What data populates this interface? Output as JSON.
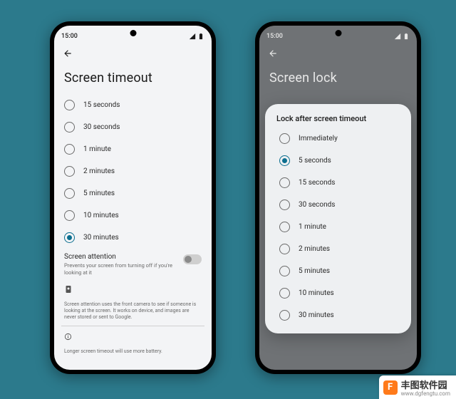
{
  "status_time": "15:00",
  "phone_left": {
    "title": "Screen timeout",
    "options": [
      {
        "label": "15 seconds",
        "selected": false
      },
      {
        "label": "30 seconds",
        "selected": false
      },
      {
        "label": "1 minute",
        "selected": false
      },
      {
        "label": "2 minutes",
        "selected": false
      },
      {
        "label": "5 minutes",
        "selected": false
      },
      {
        "label": "10 minutes",
        "selected": false
      },
      {
        "label": "30 minutes",
        "selected": true
      }
    ],
    "attention": {
      "title": "Screen attention",
      "sub": "Prevents your screen from turning off if you're looking at it",
      "note": "Screen attention uses the front camera to see if someone is looking at the screen. It works on device, and images are never stored or sent to Google.",
      "battery_note": "Longer screen timeout will use more battery."
    }
  },
  "phone_right": {
    "title": "Screen lock",
    "sheet": {
      "title": "Lock after screen timeout",
      "options": [
        {
          "label": "Immediately",
          "selected": false
        },
        {
          "label": "5 seconds",
          "selected": true
        },
        {
          "label": "15 seconds",
          "selected": false
        },
        {
          "label": "30 seconds",
          "selected": false
        },
        {
          "label": "1 minute",
          "selected": false
        },
        {
          "label": "2 minutes",
          "selected": false
        },
        {
          "label": "5 minutes",
          "selected": false
        },
        {
          "label": "10 minutes",
          "selected": false
        },
        {
          "label": "30 minutes",
          "selected": false
        }
      ]
    }
  },
  "watermark": {
    "badge": "F",
    "text": "丰图软件园",
    "url": "www.dgfengtu.com"
  }
}
